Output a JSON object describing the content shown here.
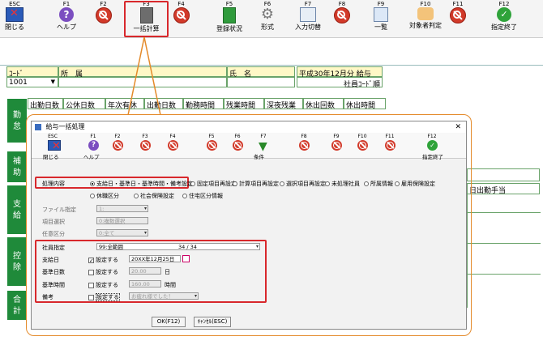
{
  "toolbar": {
    "items": [
      {
        "key": "ESC",
        "label": "閉じる",
        "icon": "close-window-icon"
      },
      {
        "key": "F1",
        "label": "ヘルプ",
        "icon": "help-icon"
      },
      {
        "key": "F2",
        "label": "",
        "icon": "no-entry-icon"
      },
      {
        "key": "F3",
        "label": "一括計算",
        "icon": "calculator-icon"
      },
      {
        "key": "F4",
        "label": "",
        "icon": "no-entry-icon"
      },
      {
        "key": "F5",
        "label": "登録状況",
        "icon": "book-icon"
      },
      {
        "key": "F6",
        "label": "形式",
        "icon": "gear-icon"
      },
      {
        "key": "F7",
        "label": "入力切替",
        "icon": "input-switch-icon"
      },
      {
        "key": "F8",
        "label": "",
        "icon": "no-entry-icon"
      },
      {
        "key": "F9",
        "label": "一覧",
        "icon": "list-icon"
      },
      {
        "key": "F10",
        "label": "対象者判定",
        "icon": "people-icon"
      },
      {
        "key": "F11",
        "label": "",
        "icon": "no-entry-icon"
      },
      {
        "key": "F12",
        "label": "指定終了",
        "icon": "check-icon"
      }
    ]
  },
  "main": {
    "code_header": "ｺｰﾄﾞ",
    "dept_header": "所　属",
    "name_header": "氏　名",
    "period": "平成30年12月分 給与",
    "code_value": "1001",
    "sort_label": "社員ｺｰﾄﾞ順",
    "columns": [
      "出勤日数",
      "公休日数",
      "年次有休",
      "出勤日数",
      "勤務時間",
      "残業時間",
      "深夜残業",
      "休出回数",
      "休出時間"
    ],
    "right_header": "日出勤手当",
    "sections": [
      "勤怠",
      "補助",
      "支給",
      "控除",
      "合計"
    ]
  },
  "dialog": {
    "title": "給与一括処理",
    "toolbar": [
      {
        "key": "ESC",
        "label": "閉じる"
      },
      {
        "key": "F1",
        "label": "ヘルプ"
      },
      {
        "key": "F2",
        "label": ""
      },
      {
        "key": "F3",
        "label": ""
      },
      {
        "key": "F4",
        "label": ""
      },
      {
        "key": "F5",
        "label": ""
      },
      {
        "key": "F6",
        "label": ""
      },
      {
        "key": "F7",
        "label": "条件"
      },
      {
        "key": "F8",
        "label": ""
      },
      {
        "key": "F9",
        "label": ""
      },
      {
        "key": "F10",
        "label": ""
      },
      {
        "key": "F11",
        "label": ""
      },
      {
        "key": "F12",
        "label": "指定終了"
      }
    ],
    "process_label": "処理内容",
    "process_options": [
      {
        "label": "支給日・基準日・基準時間・備考設定",
        "selected": true
      },
      {
        "label": "固定項目再設定",
        "selected": false
      },
      {
        "label": "計算項目再設定",
        "selected": false
      },
      {
        "label": "選択項目再設定",
        "selected": false
      },
      {
        "label": "未処理社員",
        "selected": false
      },
      {
        "label": "所属情報",
        "selected": false
      },
      {
        "label": "雇用保険設定",
        "selected": false
      },
      {
        "label": "休職区分",
        "selected": false
      },
      {
        "label": "社会保険設定",
        "selected": false
      },
      {
        "label": "住宅区分情報",
        "selected": false
      }
    ],
    "file_label": "ファイル指定",
    "file_value": "1:",
    "item_label": "項目選択",
    "item_value": "0:複数選択",
    "optional_label": "任意区分",
    "optional_value": "0:全て",
    "employee_label": "社員指定",
    "employee_value": "99:全範囲",
    "employee_count": "34 / 34",
    "payday_label": "支給日",
    "payday_check": "設定する",
    "payday_value": "20XX年12月25日",
    "baseday_label": "基準日数",
    "baseday_check": "設定する",
    "baseday_value": "20.00",
    "baseday_unit": "日",
    "basetime_label": "基準時間",
    "basetime_check": "設定する",
    "basetime_value": "160.00",
    "basetime_unit": "時間",
    "note_label": "備考",
    "note_check": "設定する",
    "note_value": "お疲れ様でした！",
    "ok_label": "OK(F12)",
    "cancel_label": "ｷｬﾝｾﾙ(ESC)"
  }
}
